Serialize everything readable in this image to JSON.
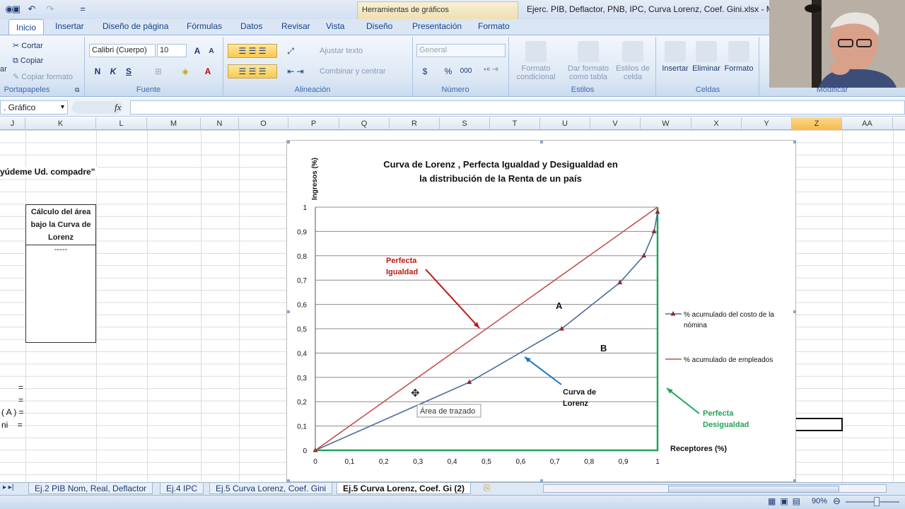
{
  "window": {
    "title": "Ejerc. PIB, Deflactor, PNB, IPC, Curva Lorenz, Coef. Gini.xlsx - Micr",
    "context_tab": "Herramientas de gráficos"
  },
  "quick_access": {
    "menu_symbol": "="
  },
  "tabs": [
    "Inicio",
    "Insertar",
    "Diseño de página",
    "Fórmulas",
    "Datos",
    "Revisar",
    "Vista",
    "Diseño",
    "Presentación",
    "Formato"
  ],
  "ribbon": {
    "portapapeles": {
      "cut": "Cortar",
      "copy": "Copiar",
      "format_painter": "Copiar formato",
      "label": "Portapapeles",
      "paste_fragment": "ar"
    },
    "fuente": {
      "font_name": "Calibri (Cuerpo)",
      "font_size": "10",
      "grow": "A",
      "shrink": "A",
      "bold": "N",
      "italic": "K",
      "underline": "S",
      "font_color_letter": "A",
      "label": "Fuente"
    },
    "alineacion": {
      "wrap": "Ajustar texto",
      "merge": "Combinar y centrar",
      "label": "Alineación"
    },
    "numero": {
      "format": "General",
      "currency": "$",
      "percent": "%",
      "thousands": "000",
      "label": "Número"
    },
    "estilos": {
      "conditional": "Formato condicional",
      "as_table": "Dar formato como tabla",
      "cell_styles": "Estilos de celda",
      "label": "Estilos"
    },
    "celdas": {
      "insert": "Insertar",
      "delete": "Eliminar",
      "format": "Formato",
      "label": "Celdas"
    },
    "modificar": {
      "label": "Modificar"
    }
  },
  "formula_bar": {
    "name_box": ". Gráfico",
    "fx": "fx",
    "value": ""
  },
  "columns": [
    {
      "label": "J",
      "sel": false
    },
    {
      "label": "K",
      "sel": false
    },
    {
      "label": "L",
      "sel": false
    },
    {
      "label": "M",
      "sel": false
    },
    {
      "label": "N",
      "sel": false
    },
    {
      "label": "O",
      "sel": false
    },
    {
      "label": "P",
      "sel": false
    },
    {
      "label": "Q",
      "sel": false
    },
    {
      "label": "R",
      "sel": false
    },
    {
      "label": "S",
      "sel": false
    },
    {
      "label": "T",
      "sel": false
    },
    {
      "label": "U",
      "sel": false
    },
    {
      "label": "V",
      "sel": false
    },
    {
      "label": "W",
      "sel": false
    },
    {
      "label": "X",
      "sel": false
    },
    {
      "label": "Y",
      "sel": false
    },
    {
      "label": "Z",
      "sel": true
    },
    {
      "label": "AA",
      "sel": false
    }
  ],
  "cells": {
    "heading": "yúdeme Ud. compadre\"",
    "area_box_title": "Cálculo del área bajo la Curva de Lorenz",
    "area_box_value": "-----",
    "row1": "=",
    "row2": "=",
    "row3": "( A ) =",
    "row4": "ni    ="
  },
  "sheet_tabs": [
    {
      "label": "Ej.2 PIB Nom, Real, Deflactor",
      "active": false
    },
    {
      "label": "Ej.4 IPC",
      "active": false
    },
    {
      "label": "Ej.5 Curva Lorenz, Coef. Gini",
      "active": false
    },
    {
      "label": "Ej.5 Curva Lorenz, Coef. Gi (2)",
      "active": true
    }
  ],
  "status": {
    "zoom": "90%"
  },
  "chart_data": {
    "type": "line",
    "title": "Curva de Lorenz , Perfecta Igualdad y Desigualdad en la distribución de la Renta de un país",
    "title_lines": [
      "Curva de Lorenz , Perfecta Igualdad y Desigualdad en",
      "la distribución de la Renta de un país"
    ],
    "xlabel": "Receptores (%)",
    "ylabel": "Ingresos (%)",
    "xlim": [
      0,
      1
    ],
    "ylim": [
      0,
      1
    ],
    "x_ticks": [
      "0",
      "0,1",
      "0,2",
      "0,3",
      "0,4",
      "0,5",
      "0,6",
      "0,7",
      "0,8",
      "0,9",
      "1"
    ],
    "y_ticks": [
      "0",
      "0,1",
      "0,2",
      "0,3",
      "0,4",
      "0,5",
      "0,6",
      "0,7",
      "0,8",
      "0,9",
      "1"
    ],
    "grid": true,
    "legend_position": "right",
    "series": [
      {
        "name": "% acumulado del costo de la nómina",
        "color": "#4a6aa0",
        "x": [
          0,
          0.45,
          0.72,
          0.89,
          0.96,
          0.99,
          1
        ],
        "y": [
          0,
          0.28,
          0.5,
          0.69,
          0.8,
          0.9,
          0.98
        ]
      },
      {
        "name": "% acumulado de empleados",
        "color": "#c0504d",
        "x": [
          0,
          1
        ],
        "y": [
          0,
          1
        ]
      }
    ],
    "perfect_inequality": {
      "color": "#21a45a",
      "x": [
        0,
        1,
        1
      ],
      "y": [
        0,
        0,
        1
      ]
    },
    "annotations": [
      {
        "text": "Perfecta Igualdad",
        "lines": [
          "Perfecta",
          "Igualdad"
        ],
        "color": "#c0180f"
      },
      {
        "text": "A",
        "lines": [
          "A"
        ],
        "color": "#111111"
      },
      {
        "text": "B",
        "lines": [
          "B"
        ],
        "color": "#111111"
      },
      {
        "text": "Curva de Lorenz",
        "lines": [
          "Curva de",
          "Lorenz"
        ],
        "color": "#111111"
      },
      {
        "text": "Perfecta Desigualdad",
        "lines": [
          "Perfecta",
          "Desigualdad"
        ],
        "color": "#21a45a"
      }
    ],
    "tooltip": "Área de trazado"
  }
}
